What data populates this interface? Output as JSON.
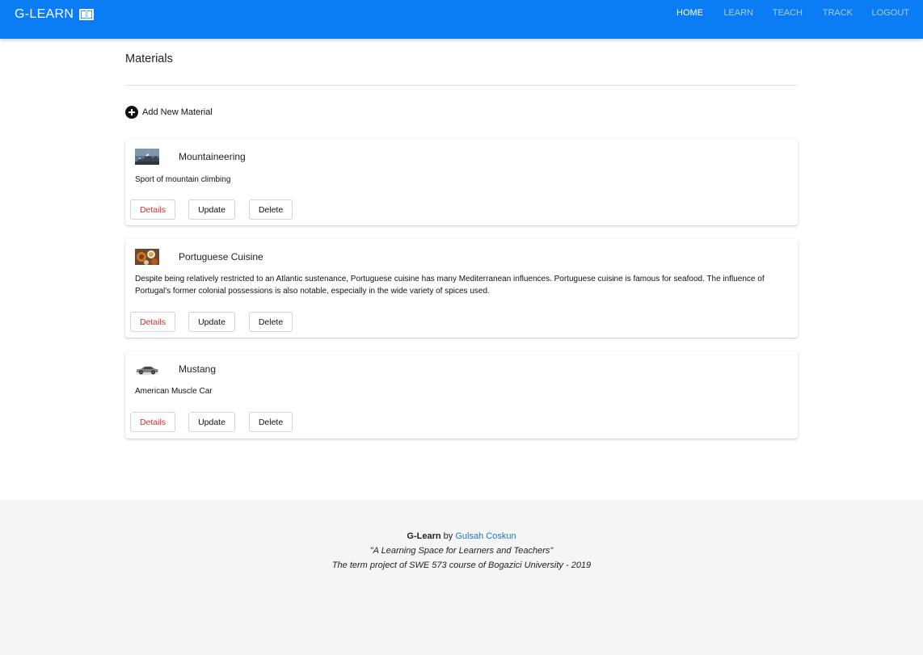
{
  "navbar": {
    "brand": "G-LEARN",
    "brand_icon": "book-icon",
    "links": [
      {
        "label": "HOME",
        "active": true
      },
      {
        "label": "LEARN",
        "active": false
      },
      {
        "label": "TEACH",
        "active": false
      },
      {
        "label": "TRACK",
        "active": false
      },
      {
        "label": "LOGOUT",
        "active": false
      }
    ]
  },
  "main": {
    "title": "Materials",
    "add_label": "Add New Material",
    "add_icon": "plus-circle-icon"
  },
  "materials": [
    {
      "title": "Mountaineering",
      "thumbnail": "mountain-photo",
      "description": "Sport of mountain climbing"
    },
    {
      "title": "Portuguese Cuisine",
      "thumbnail": "food-photo",
      "description": "Despite being relatively restricted to an Atlantic sustenance, Portuguese cuisine has many Mediterranean influences. Portuguese cuisine is famous for seafood. The influence of Portugal's former colonial possessions is also notable, especially in the wide variety of spices used."
    },
    {
      "title": "Mustang",
      "thumbnail": "car-photo",
      "description": "American Muscle Car"
    }
  ],
  "card_actions": {
    "details": "Details",
    "update": "Update",
    "delete": "Delete"
  },
  "footer": {
    "brand": "G-Learn",
    "by": "by",
    "author": "Gulsah Coskun",
    "tagline": "\"A Learning Space for Learners and Teachers\"",
    "note": "The term project of SWE 573 course of Bogazici University - 2019"
  },
  "colors": {
    "navbar": "#0a7df5",
    "details_text": "#d32f2f",
    "link": "#1976d2",
    "footer_bg": "#f5f5f5"
  }
}
